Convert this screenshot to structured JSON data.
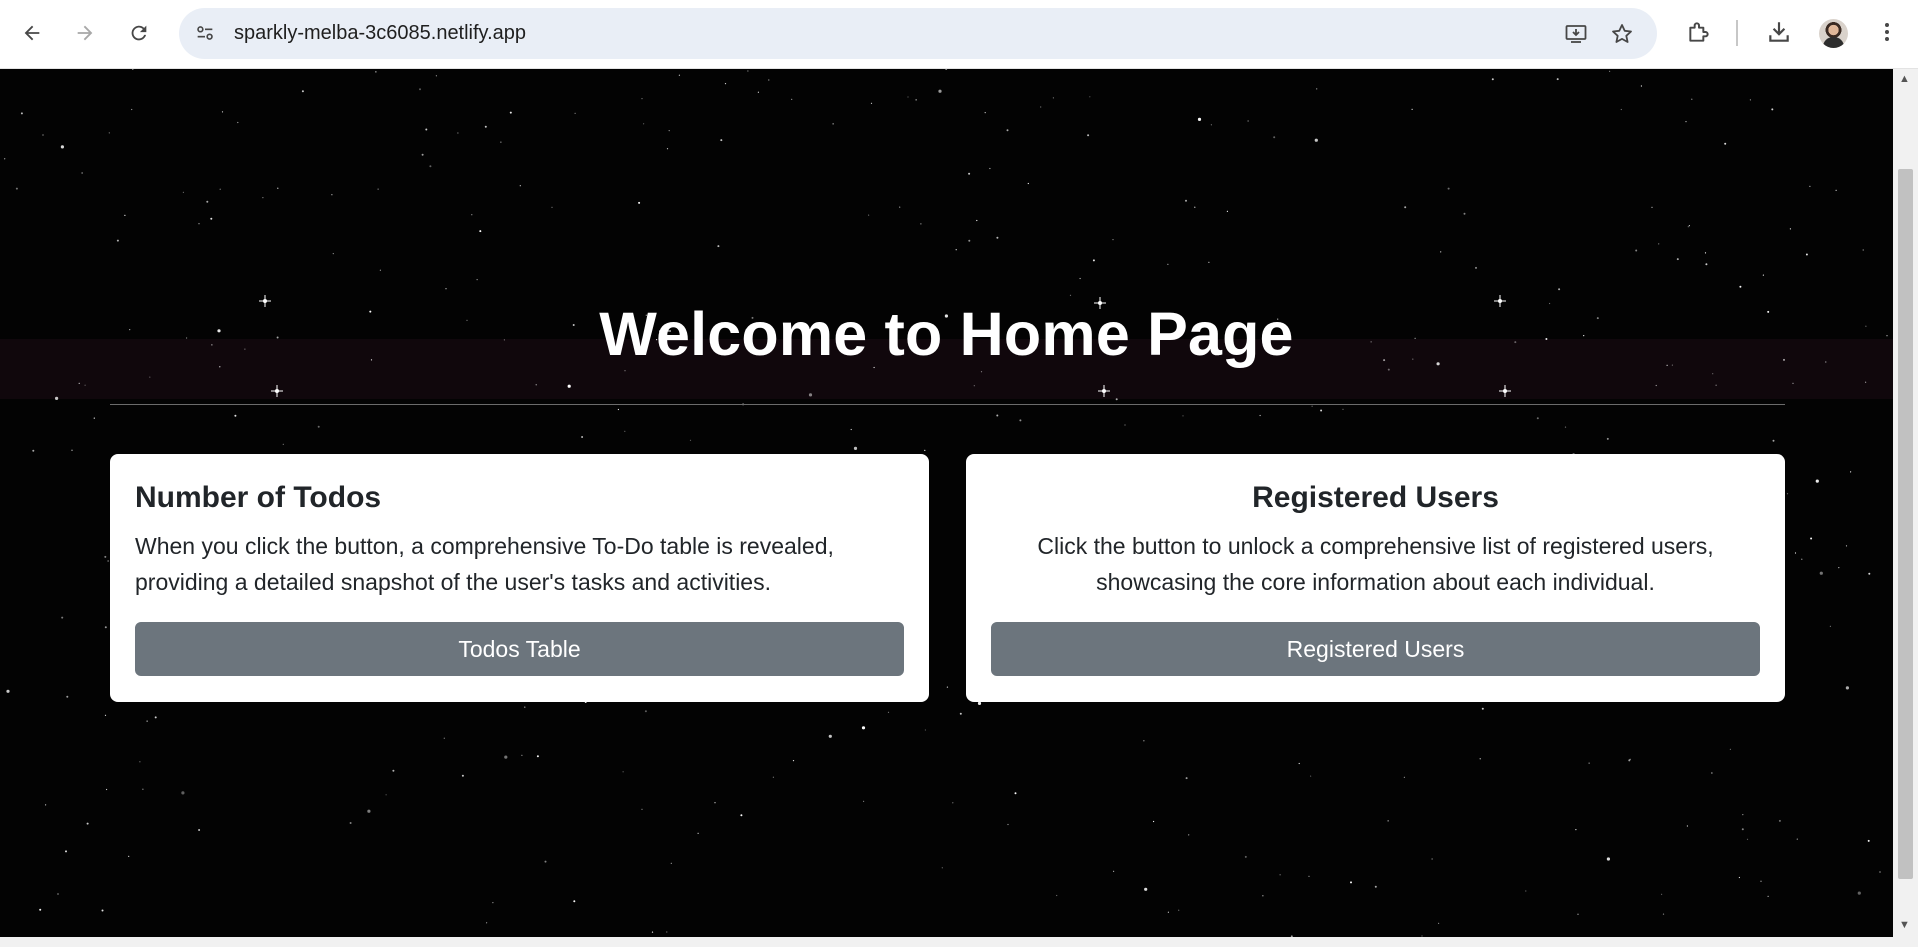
{
  "browser": {
    "url": "sparkly-melba-3c6085.netlify.app",
    "icons": [
      "back-arrow-icon",
      "forward-arrow-icon",
      "reload-icon",
      "site-settings-icon",
      "install-app-icon",
      "star-icon",
      "extensions-icon",
      "download-icon",
      "profile-avatar",
      "kebab-menu-icon"
    ]
  },
  "page": {
    "title": "Welcome to Home Page",
    "cards": [
      {
        "heading": "Number of Todos",
        "text": "When you click the button, a comprehensive To-Do table is revealed, providing a detailed snapshot of the user's tasks and activities.",
        "button": "Todos Table"
      },
      {
        "heading": "Registered Users",
        "text": "Click the button to unlock a comprehensive list of registered users, showcasing the core information about each individual.",
        "button": "Registered Users"
      }
    ]
  },
  "colors": {
    "background": "#030303",
    "card": "#ffffff",
    "button": "#6c757d",
    "omnibox": "#e9eef6"
  }
}
